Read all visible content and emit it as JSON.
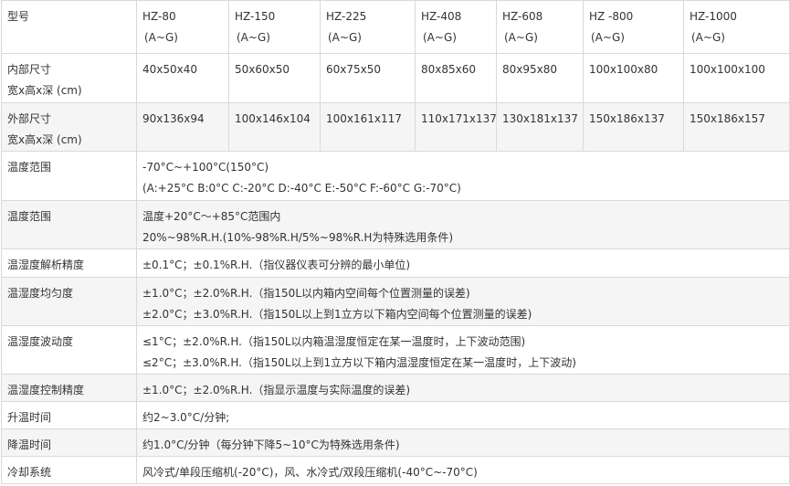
{
  "header": {
    "label": "型号",
    "models": [
      {
        "name": "HZ-80",
        "range": "(A~G)"
      },
      {
        "name": "HZ-150",
        "range": "(A~G)"
      },
      {
        "name": "HZ-225",
        "range": "(A~G)"
      },
      {
        "name": "HZ-408",
        "range": "(A~G)"
      },
      {
        "name": "HZ-608",
        "range": "(A~G)"
      },
      {
        "name": "HZ -800",
        "range": "(A~G)"
      },
      {
        "name": "HZ-1000",
        "range": "(A~G)"
      }
    ]
  },
  "inner_size": {
    "label_line1": "内部尺寸",
    "label_line2": "宽x高x深 (cm)",
    "values": [
      "40x50x40",
      "50x60x50",
      "60x75x50",
      "80x85x60",
      "80x95x80",
      "100x100x80",
      "100x100x100"
    ]
  },
  "outer_size": {
    "label_line1": "外部尺寸",
    "label_line2": "宽x高x深 (cm)",
    "values": [
      "90x136x94",
      "100x146x104",
      "100x161x117",
      "110x171x137",
      "130x181x137",
      "150x186x137",
      "150x186x157"
    ]
  },
  "rows": [
    {
      "label": "温度范围",
      "lines": [
        "-70°C~+100°C(150°C)",
        "(A:+25°C B:0°C C:-20°C D:-40°C E:-50°C F:-60°C   G:-70°C)"
      ]
    },
    {
      "label": "温度范围",
      "lines": [
        "温度+20°C～+85°C范围内",
        "20%~98%R.H.(10%-98%R.H/5%~98%R.H为特殊选用条件)"
      ]
    },
    {
      "label": "温湿度解析精度",
      "lines": [
        "±0.1°C；±0.1%R.H.（指仪器仪表可分辨的最小单位)"
      ]
    },
    {
      "label": "温湿度均匀度",
      "lines": [
        "±1.0°C；±2.0%R.H.（指150L以内箱内空间每个位置测量的误差)",
        "±2.0°C；±3.0%R.H.（指150L以上到1立方以下箱内空间每个位置测量的误差)"
      ]
    },
    {
      "label": "温湿度波动度",
      "lines": [
        "≤1°C；±2.0%R.H.（指150L以内箱温湿度恒定在某一温度时，上下波动范围)",
        "≤2°C；±3.0%R.H.（指150L以上到1立方以下箱内温湿度恒定在某一温度时，上下波动)"
      ]
    },
    {
      "label": "温湿度控制精度",
      "lines": [
        "±1.0°C；±2.0%R.H.（指显示温度与实际温度的误差)"
      ]
    },
    {
      "label": "升温时间",
      "lines": [
        "约2~3.0°C/分钟;"
      ]
    },
    {
      "label": "降温时间",
      "lines": [
        "约1.0°C/分钟（每分钟下降5~10°C为特殊选用条件)"
      ]
    },
    {
      "label": "冷却系统",
      "lines": [
        "风冷式/单段压缩机(-20°C)，风、水冷式/双段压缩机(-40°C~-70°C)"
      ]
    }
  ]
}
